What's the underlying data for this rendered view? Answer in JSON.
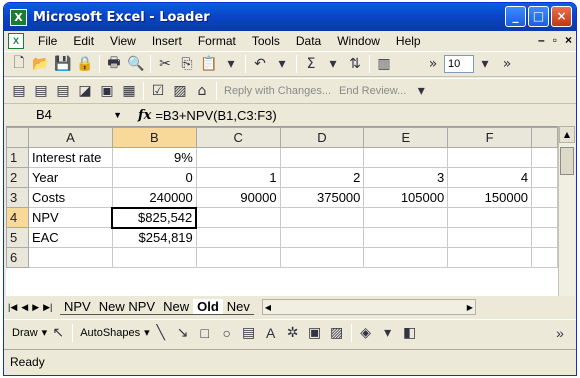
{
  "window": {
    "title": "Microsoft Excel - Loader"
  },
  "menu": [
    "File",
    "Edit",
    "View",
    "Insert",
    "Format",
    "Tools",
    "Data",
    "Window",
    "Help"
  ],
  "toolbar": {
    "font_size": "10",
    "reply_text": "Reply with Changes...",
    "end_review": "End Review..."
  },
  "formula_bar": {
    "name_box": "B4",
    "fx": "fx",
    "formula": "=B3+NPV(B1,C3:F3)"
  },
  "grid": {
    "columns": [
      "A",
      "B",
      "C",
      "D",
      "E",
      "F"
    ],
    "rows": [
      {
        "n": "1",
        "cells": [
          "Interest rate",
          "9%",
          "",
          "",
          "",
          ""
        ]
      },
      {
        "n": "2",
        "cells": [
          "Year",
          "0",
          "1",
          "2",
          "3",
          "4"
        ]
      },
      {
        "n": "3",
        "cells": [
          "Costs",
          "240000",
          "90000",
          "375000",
          "105000",
          "150000"
        ]
      },
      {
        "n": "4",
        "cells": [
          "NPV",
          "$825,542",
          "",
          "",
          "",
          ""
        ]
      },
      {
        "n": "5",
        "cells": [
          "EAC",
          "$254,819",
          "",
          "",
          "",
          ""
        ]
      },
      {
        "n": "6",
        "cells": [
          "",
          "",
          "",
          "",
          "",
          ""
        ]
      }
    ]
  },
  "sheets": [
    "NPV",
    "New NPV",
    "New",
    "Old",
    "Nev"
  ],
  "active_sheet": "Old",
  "drawing": {
    "draw": "Draw",
    "autoshapes": "AutoShapes"
  },
  "status": "Ready",
  "accent": "#0a46c8"
}
